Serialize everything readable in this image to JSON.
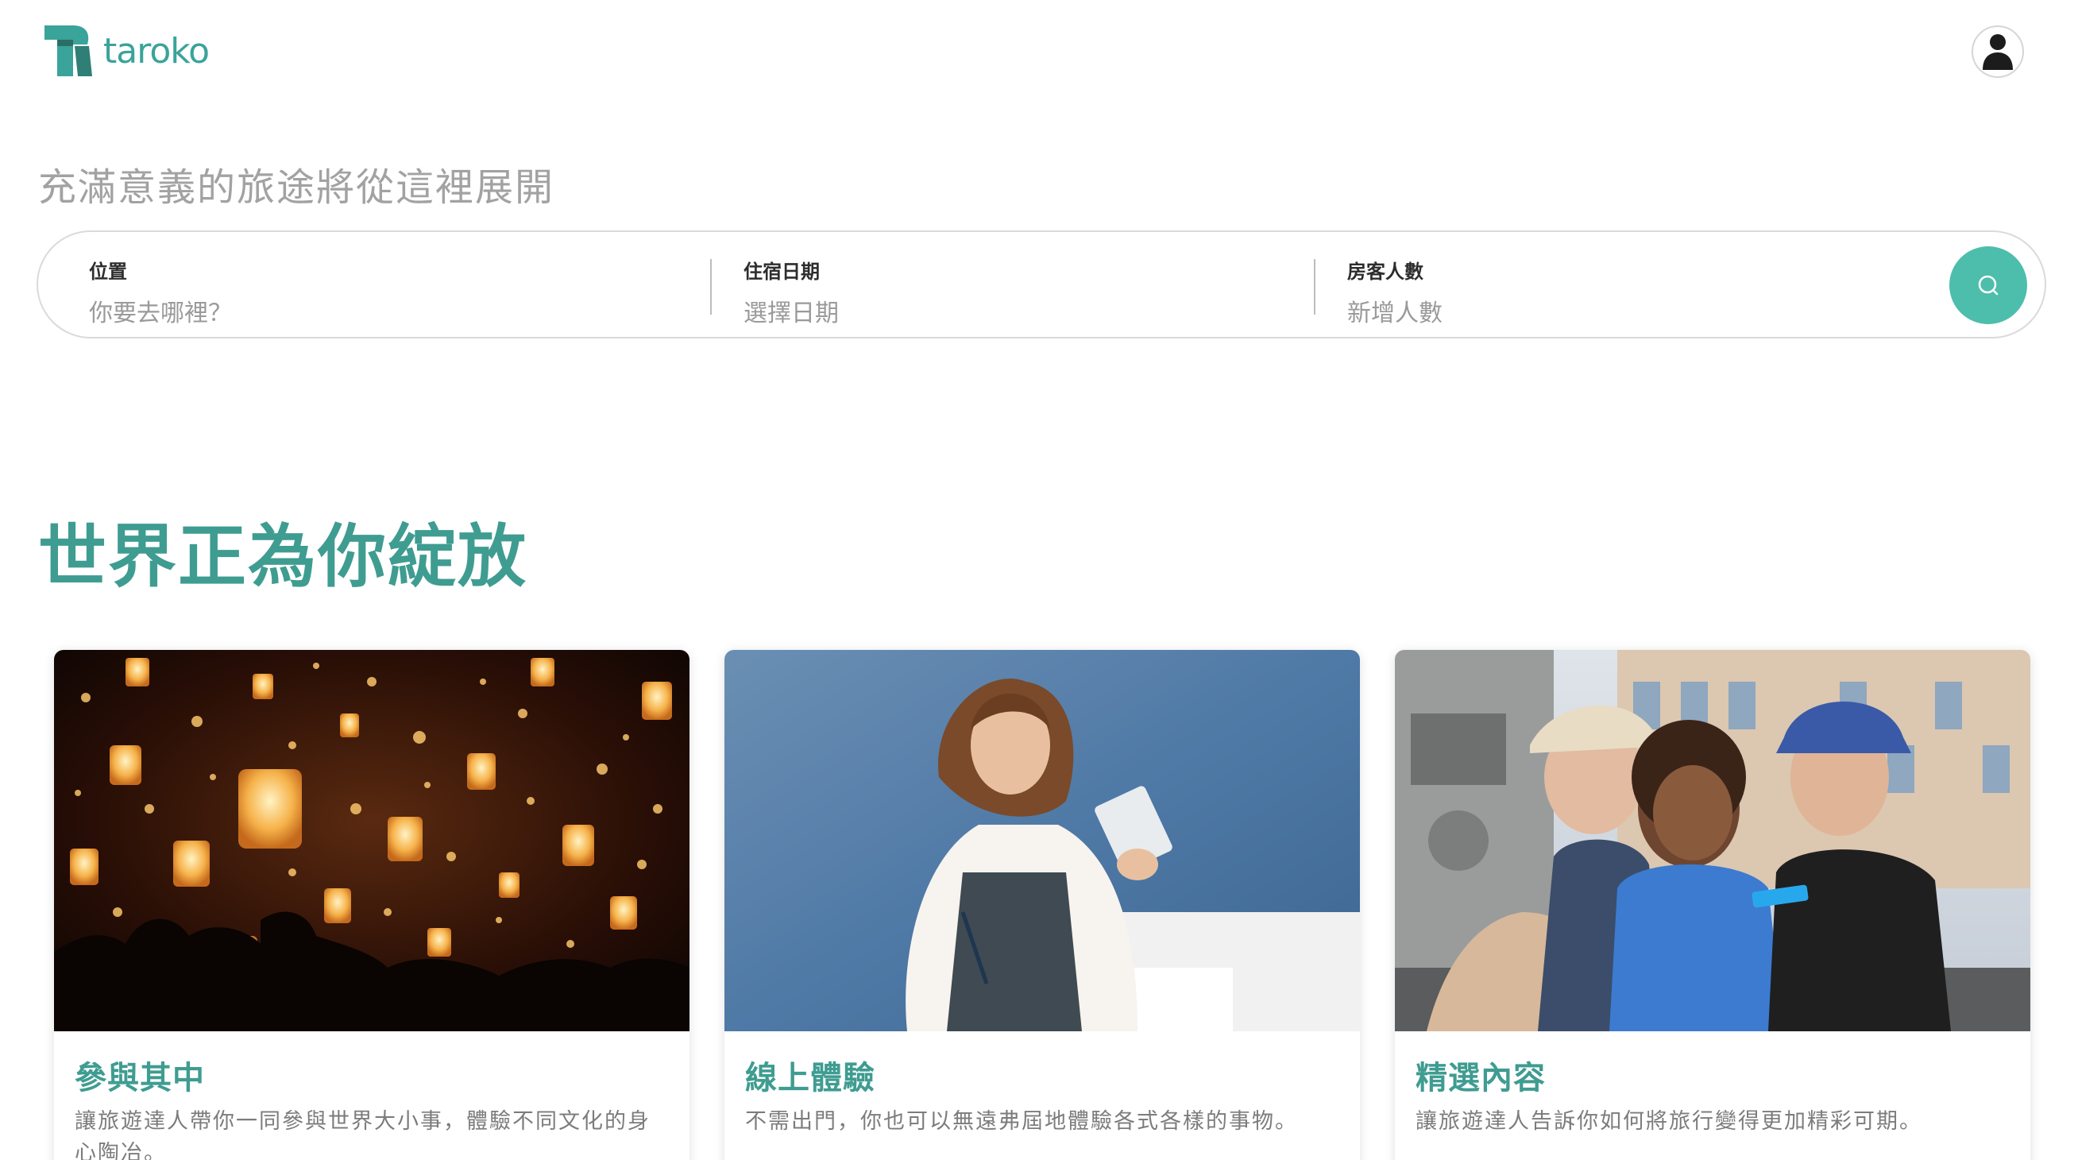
{
  "header": {
    "logo_text": "taroko",
    "logo_icon": "taroko-logo-icon",
    "avatar_icon": "user-icon"
  },
  "tagline": "充滿意義的旅途將從這裡展開",
  "search": {
    "location": {
      "label": "位置",
      "placeholder": "你要去哪裡？"
    },
    "dates": {
      "label": "住宿日期",
      "placeholder": "選擇日期"
    },
    "guests": {
      "label": "房客人數",
      "placeholder": "新增人數"
    },
    "button_icon": "search-icon"
  },
  "section": {
    "title": "世界正為你綻放"
  },
  "cards": [
    {
      "title": "參與其中",
      "description": "讓旅遊達人帶你一同參與世界大小事，體驗不同文化的身心陶冶。"
    },
    {
      "title": "線上體驗",
      "description": "不需出門，你也可以無遠弗屆地體驗各式各樣的事物。"
    },
    {
      "title": "精選內容",
      "description": "讓旅遊達人告訴你如何將旅行變得更加精彩可期。"
    }
  ],
  "colors": {
    "brand": "#3aa39a",
    "accent": "#4dbeab",
    "title": "#3f9c91"
  }
}
